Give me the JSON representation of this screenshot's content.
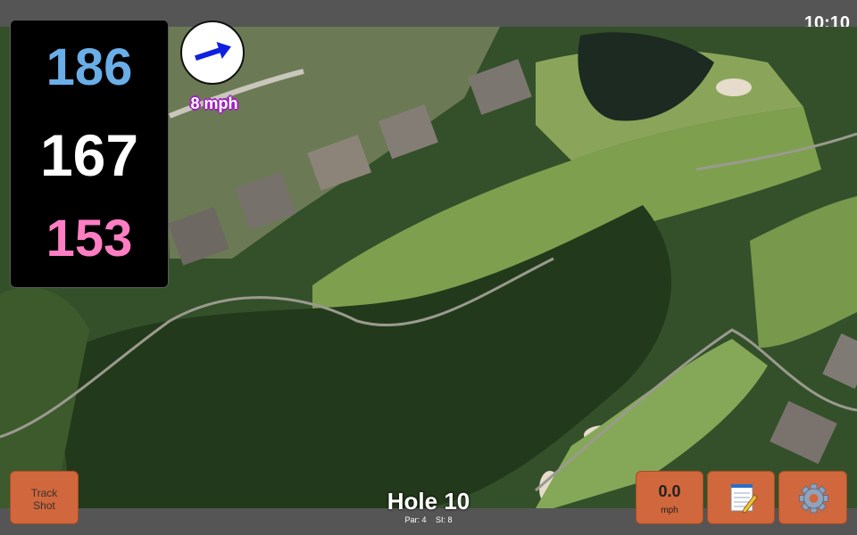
{
  "status_bar": {
    "time": "10:10"
  },
  "distances": {
    "back": "186",
    "middle": "167",
    "front": "153"
  },
  "wind": {
    "speed_label": "8 mph",
    "direction": "east"
  },
  "hole": {
    "title": "Hole 10",
    "par_label": "Par: 4",
    "si_label": "SI: 8"
  },
  "buttons": {
    "track_shot_label": "Track Shot",
    "wind_value": "0.0",
    "wind_unit": "mph"
  },
  "colors": {
    "back": "#6aaee8",
    "middle": "#ffffff",
    "front": "#ff7ec3",
    "button": "#d1673c",
    "wind_outline": "#a020c0"
  },
  "icons": [
    "wind-arrow-icon",
    "notepad-icon",
    "gear-icon"
  ]
}
